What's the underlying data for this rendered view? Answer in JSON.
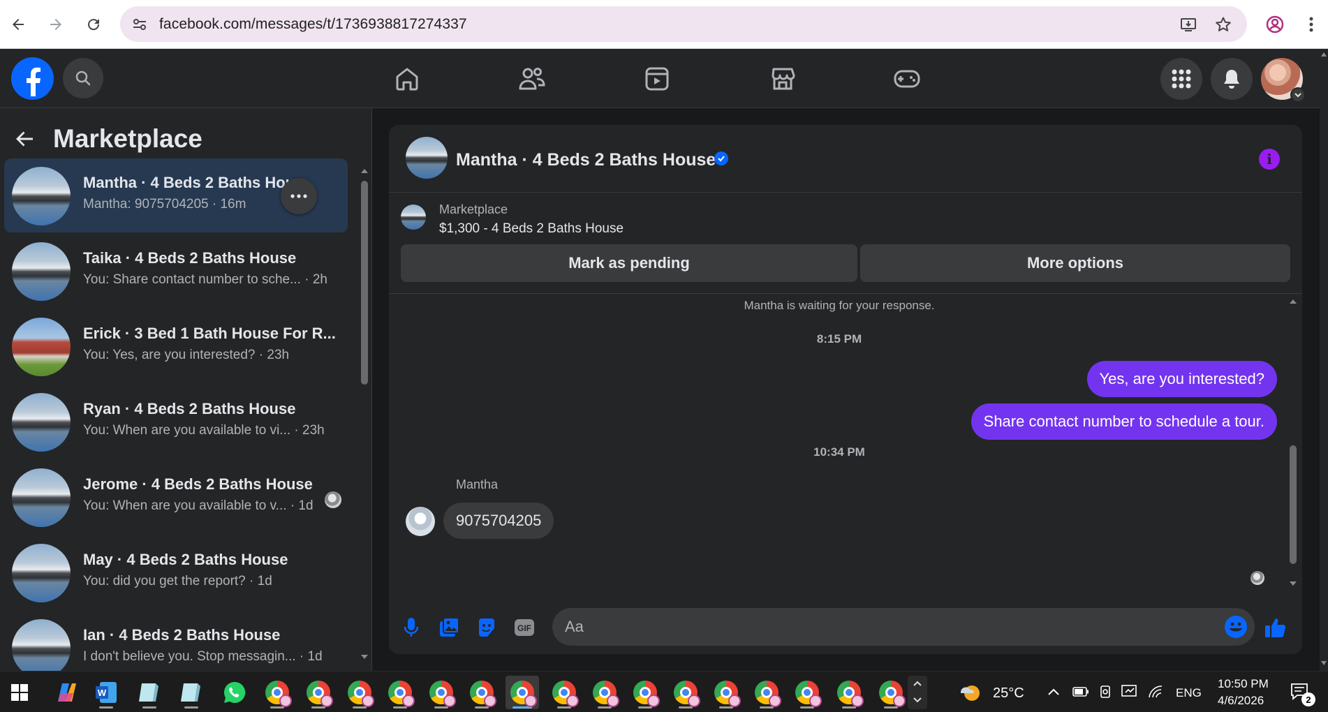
{
  "browser": {
    "url": "facebook.com/messages/t/1736938817274337"
  },
  "left_panel": {
    "title": "Marketplace",
    "conversations": [
      {
        "name": "Mantha · 4 Beds 2 Baths Hou",
        "subtitle": "Mantha: 9075704205 · 16m",
        "active": true
      },
      {
        "name": "Taika · 4 Beds 2 Baths House",
        "subtitle": "You: Share contact number to sche... · 2h"
      },
      {
        "name": "Erick · 3 Bed 1 Bath House For R...",
        "subtitle": "You: Yes, are you interested? · 23h"
      },
      {
        "name": "Ryan · 4 Beds 2 Baths House",
        "subtitle": "You: When are you available to vi... · 23h"
      },
      {
        "name": "Jerome · 4 Beds 2 Baths House",
        "subtitle": "You: When are you available to v... · 1d"
      },
      {
        "name": "May · 4 Beds 2 Baths House",
        "subtitle": "You: did you get the report? · 1d"
      },
      {
        "name": "Ian · 4 Beds 2 Baths House",
        "subtitle": "I don't believe you. Stop messagin... · 1d"
      }
    ]
  },
  "chat": {
    "title": "Mantha · 4 Beds 2 Baths House",
    "listing": {
      "label": "Marketplace",
      "price_title": "$1,300 - 4 Beds 2 Baths House",
      "mark_pending_label": "Mark as pending",
      "more_options_label": "More options"
    },
    "status": "Mantha is waiting for your response.",
    "time1": "8:15 PM",
    "out_messages": [
      "Yes, are you interested?",
      "Share contact number to schedule a tour."
    ],
    "time2": "10:34 PM",
    "sender": "Mantha",
    "in_message": "9075704205",
    "composer_placeholder": "Aa"
  },
  "taskbar": {
    "weather": "25°C",
    "language": "ENG",
    "time": "10:50 PM",
    "date": "4/6/2026",
    "notifications": "2"
  },
  "colors": {
    "fb_blue": "#0866ff",
    "outgoing_bubble": "#7334f0",
    "active_conversation": "#263951"
  }
}
